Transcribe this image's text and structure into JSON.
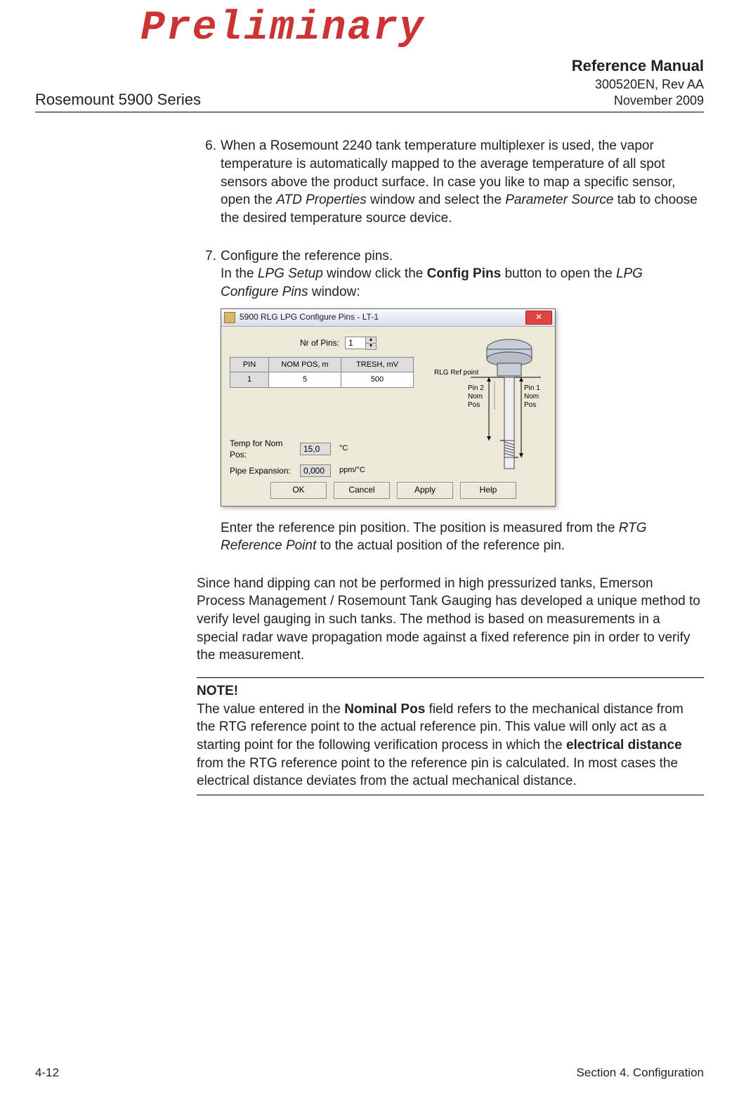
{
  "watermark": "Preliminary",
  "header": {
    "left": "Rosemount 5900 Series",
    "right_title": "Reference Manual",
    "right_doc": "300520EN, Rev AA",
    "right_date": "November 2009"
  },
  "items": {
    "num6": "6.",
    "body6_a": "When a Rosemount 2240 tank temperature multiplexer is used, the vapor temperature is automatically mapped to the average temperature of all spot sensors above the product surface. In case you like to map a specific sensor, open the ",
    "body6_b": "ATD Properties",
    "body6_c": " window and select the ",
    "body6_d": "Parameter Source",
    "body6_e": " tab to choose the desired temperature source device.",
    "num7": "7.",
    "body7_line1": "Configure the reference pins.",
    "body7_a": "In the ",
    "body7_b": "LPG Setup",
    "body7_c": " window click the ",
    "body7_d": "Config Pins",
    "body7_e": " button to open the ",
    "body7_f": "LPG Configure Pins",
    "body7_g": " window:",
    "after_dialog_a": "Enter the reference pin position. The position is measured from the ",
    "after_dialog_b": "RTG Reference Point",
    "after_dialog_c": " to the actual position of the reference pin."
  },
  "para_hand": "Since hand dipping can not be performed in high pressurized tanks, Emerson Process Management / Rosemount Tank Gauging has developed a unique method to verify level gauging in such tanks. The method is based on measurements in a special radar wave propagation mode against a fixed reference pin in order to verify the measurement.",
  "note": {
    "heading": "NOTE!",
    "a": "The value entered in the ",
    "b": "Nominal Pos",
    "c": " field refers to the mechanical distance from the RTG reference point to the actual reference pin. This value will only act as a starting point for the following verification process in which the ",
    "d": "electrical distance",
    "e": " from the RTG reference point to the reference pin is calculated. In most cases the electrical distance deviates from the actual mechanical distance."
  },
  "dialog": {
    "title": "5900 RLG LPG Configure Pins - LT-1",
    "nr_pins_label": "Nr of Pins:",
    "nr_pins_value": "1",
    "table": {
      "h1": "PIN",
      "h2": "NOM POS, m",
      "h3": "TRESH, mV",
      "r1c1": "1",
      "r1c2": "5",
      "r1c3": "500"
    },
    "temp_label": "Temp for Nom Pos:",
    "temp_value": "15,0",
    "temp_unit": "°C",
    "pipe_label": "Pipe Expansion:",
    "pipe_value": "0,000",
    "pipe_unit": "ppm/°C",
    "btn_ok": "OK",
    "btn_cancel": "Cancel",
    "btn_apply": "Apply",
    "btn_help": "Help",
    "diagram": {
      "rlg_ref": "RLG Ref point",
      "pin2": "Pin 2\nNom\nPos",
      "pin1": "Pin 1\nNom\nPos"
    }
  },
  "footer": {
    "left": "4-12",
    "right": "Section 4. Configuration"
  }
}
